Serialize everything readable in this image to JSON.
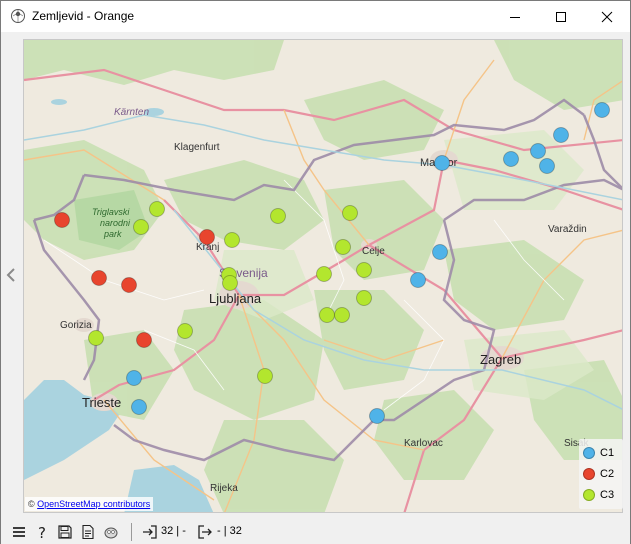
{
  "window": {
    "title": "Zemljevid - Orange"
  },
  "map": {
    "attribution_prefix": "©",
    "attribution_link": "OpenStreetMap contributors",
    "labels": {
      "karnten": "Kärnten",
      "klagenfurt": "Klagenfurt",
      "triglav_1": "Triglavski",
      "triglav_2": "narodni",
      "triglav_3": "park",
      "kranj": "Kranj",
      "slovenija": "Slovenija",
      "ljubljana": "Ljubljana",
      "celje": "Celje",
      "maribor": "Maribor",
      "varazdin": "Varaždin",
      "gorizia": "Gorizia",
      "trieste": "Trieste",
      "zagreb": "Zagreb",
      "karlovac": "Karlovac",
      "rijeka": "Rijeka",
      "sisak": "Sisak"
    }
  },
  "legend": {
    "items": [
      {
        "label": "C1",
        "color": "#4fb3e8"
      },
      {
        "label": "C2",
        "color": "#e8452e"
      },
      {
        "label": "C3",
        "color": "#b3e62e"
      }
    ]
  },
  "points": [
    {
      "cluster": "C1"
    },
    {
      "cluster": "C1"
    },
    {
      "cluster": "C1"
    },
    {
      "cluster": "C1"
    },
    {
      "cluster": "C1"
    },
    {
      "cluster": "C1"
    },
    {
      "cluster": "C1"
    },
    {
      "cluster": "C1"
    },
    {
      "cluster": "C1"
    },
    {
      "cluster": "C1"
    },
    {
      "cluster": "C1"
    },
    {
      "cluster": "C2"
    },
    {
      "cluster": "C2"
    },
    {
      "cluster": "C2"
    },
    {
      "cluster": "C2"
    },
    {
      "cluster": "C2"
    },
    {
      "cluster": "C3"
    },
    {
      "cluster": "C3"
    },
    {
      "cluster": "C3"
    },
    {
      "cluster": "C3"
    },
    {
      "cluster": "C3"
    },
    {
      "cluster": "C3"
    },
    {
      "cluster": "C3"
    },
    {
      "cluster": "C3"
    },
    {
      "cluster": "C3"
    },
    {
      "cluster": "C3"
    },
    {
      "cluster": "C3"
    },
    {
      "cluster": "C3"
    },
    {
      "cluster": "C3"
    },
    {
      "cluster": "C3"
    },
    {
      "cluster": "C3"
    },
    {
      "cluster": "C3"
    }
  ],
  "statusbar": {
    "input_count": "32 | -",
    "output_count": "- | 32"
  },
  "icons": {
    "menu": "hamburger-icon",
    "help": "help-icon",
    "save": "save-icon",
    "report": "report-icon",
    "visualize": "visualize-icon",
    "input": "input-icon",
    "output": "output-icon"
  }
}
